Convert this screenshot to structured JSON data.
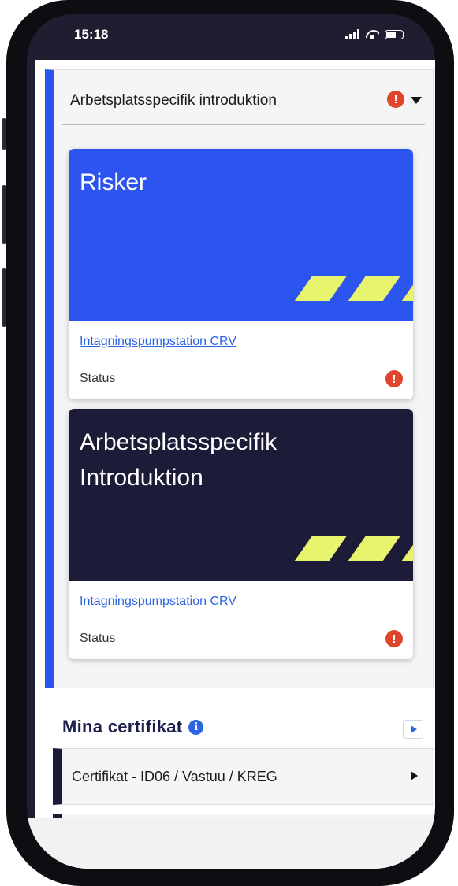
{
  "status_bar": {
    "time": "15:18"
  },
  "intro_section": {
    "title": "Arbetsplatsspecifik introduktion",
    "cards": [
      {
        "title": "Risker",
        "link": "Intagningspumpstation CRV",
        "status_label": "Status",
        "banner_color": "#2b55ee"
      },
      {
        "title": "Arbetsplatsspecifik Introduktion",
        "link": "Intagningspumpstation CRV",
        "status_label": "Status",
        "banner_color": "#1c1c38"
      }
    ]
  },
  "certificates": {
    "title": "Mina certifikat",
    "items": [
      {
        "label": "Certifikat - ID06 / Vastuu / KREG"
      }
    ]
  },
  "colors": {
    "accent": "#2b55ee",
    "alert": "#e0442d",
    "stripe": "#e8f46e",
    "dark": "#1c1c38",
    "link": "#2b63e3"
  },
  "icons": [
    "alert-icon",
    "caret-down-icon",
    "info-icon",
    "play-icon",
    "caret-right-icon",
    "signal-icon",
    "wifi-icon",
    "battery-icon"
  ]
}
